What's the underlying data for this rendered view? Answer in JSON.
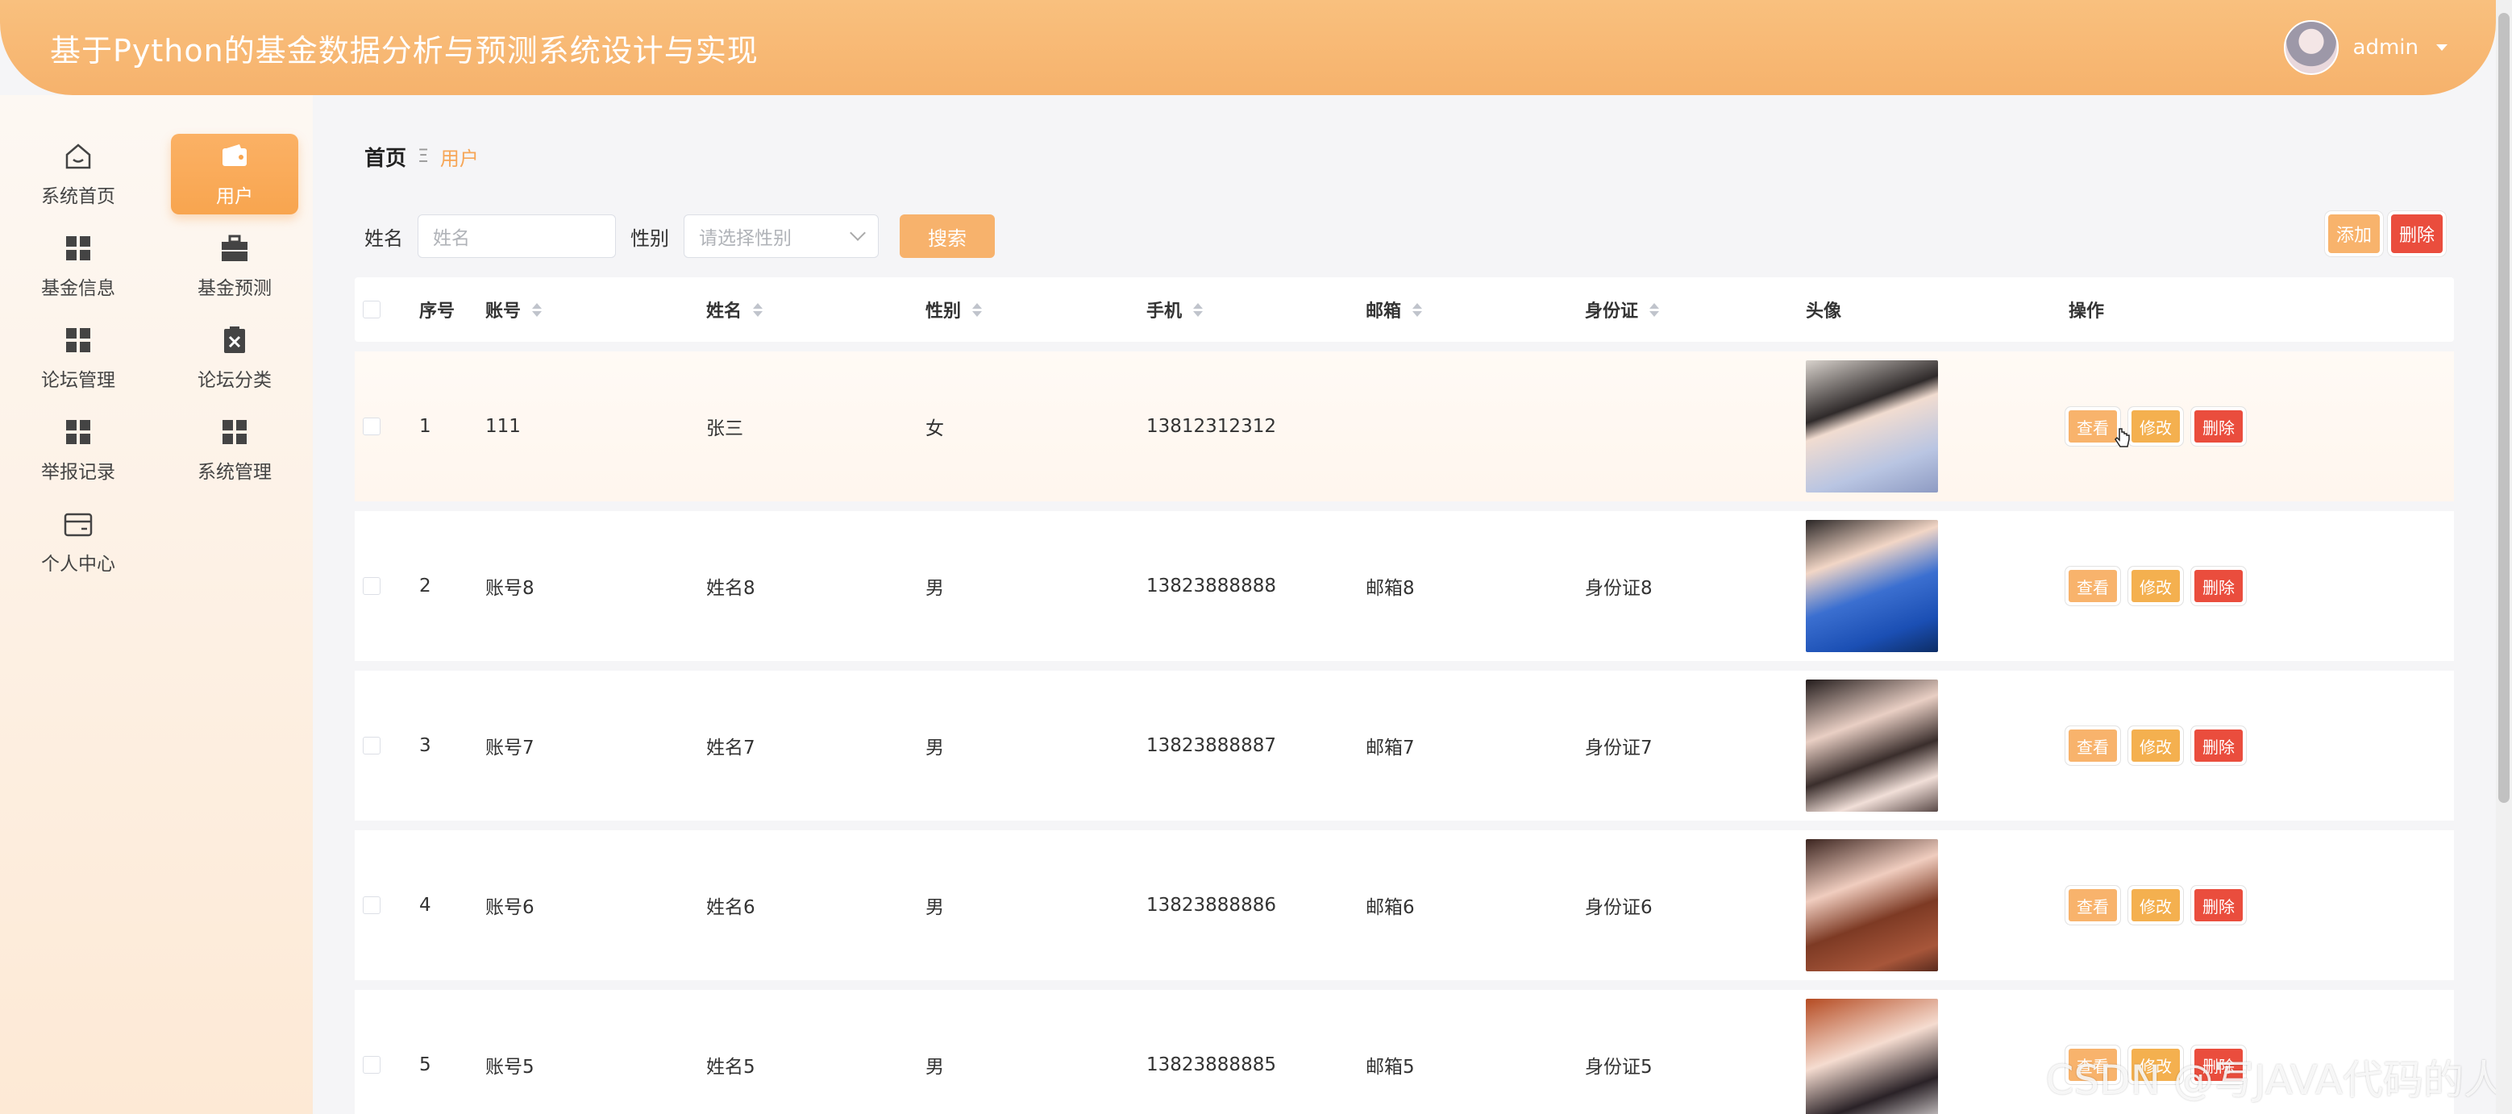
{
  "header": {
    "title": "基于Python的基金数据分析与预测系统设计与实现",
    "username": "admin"
  },
  "sidebar": {
    "items": [
      {
        "label": "系统首页",
        "icon": "home-icon",
        "active": false
      },
      {
        "label": "用户",
        "icon": "wallet-icon",
        "active": true
      },
      {
        "label": "基金信息",
        "icon": "grid-icon",
        "active": false
      },
      {
        "label": "基金预测",
        "icon": "briefcase-icon",
        "active": false
      },
      {
        "label": "论坛管理",
        "icon": "grid-icon",
        "active": false
      },
      {
        "label": "论坛分类",
        "icon": "clipboard-x-icon",
        "active": false
      },
      {
        "label": "举报记录",
        "icon": "grid-icon",
        "active": false
      },
      {
        "label": "系统管理",
        "icon": "grid-icon",
        "active": false
      },
      {
        "label": "个人中心",
        "icon": "card-icon",
        "active": false
      }
    ]
  },
  "breadcrumb": {
    "home": "首页",
    "separator": "Ξ",
    "current": "用户"
  },
  "filter": {
    "name_label": "姓名",
    "name_placeholder": "姓名",
    "sex_label": "性别",
    "sex_placeholder": "请选择性别",
    "search_label": "搜索"
  },
  "actions": {
    "add": "添加",
    "delete": "删除"
  },
  "table": {
    "headers": {
      "idx": "序号",
      "account": "账号",
      "name": "姓名",
      "sex": "性别",
      "phone": "手机",
      "email": "邮箱",
      "idcard": "身份证",
      "avatar": "头像",
      "ops": "操作"
    },
    "op_labels": {
      "view": "查看",
      "edit": "修改",
      "delete": "删除"
    },
    "rows": [
      {
        "idx": "1",
        "account": "111",
        "name": "张三",
        "sex": "女",
        "phone": "13812312312",
        "email": "",
        "idcard": ""
      },
      {
        "idx": "2",
        "account": "账号8",
        "name": "姓名8",
        "sex": "男",
        "phone": "13823888888",
        "email": "邮箱8",
        "idcard": "身份证8"
      },
      {
        "idx": "3",
        "account": "账号7",
        "name": "姓名7",
        "sex": "男",
        "phone": "13823888887",
        "email": "邮箱7",
        "idcard": "身份证7"
      },
      {
        "idx": "4",
        "account": "账号6",
        "name": "姓名6",
        "sex": "男",
        "phone": "13823888886",
        "email": "邮箱6",
        "idcard": "身份证6"
      },
      {
        "idx": "5",
        "account": "账号5",
        "name": "姓名5",
        "sex": "男",
        "phone": "13823888885",
        "email": "邮箱5",
        "idcard": "身份证5"
      }
    ]
  },
  "watermark": "CSDN @写JAVA代码的人",
  "colors": {
    "accent": "#f7b26c",
    "danger": "#ea4d3d"
  }
}
